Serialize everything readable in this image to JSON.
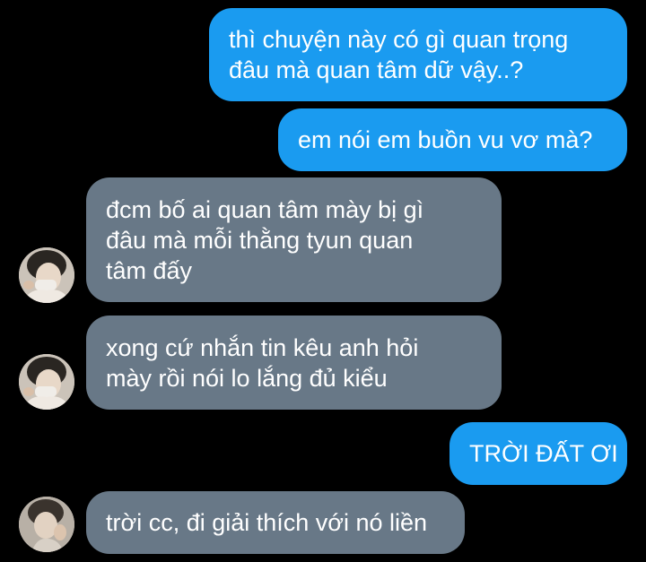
{
  "colors": {
    "background": "#000000",
    "outgoing_bubble": "#1a9bf0",
    "incoming_bubble": "#687887",
    "text": "#ffffff"
  },
  "messages": [
    {
      "direction": "outgoing",
      "lines": [
        "thì chuyện này có gì quan trọng",
        "đâu mà quan tâm dữ vậy..?"
      ]
    },
    {
      "direction": "outgoing",
      "lines": [
        "em nói em buồn vu vơ mà?"
      ]
    },
    {
      "direction": "incoming",
      "avatar": "profile-photo",
      "lines": [
        "đcm bố ai quan tâm mày bị gì",
        "đâu mà mỗi thằng tyun quan",
        "tâm đấy"
      ]
    },
    {
      "direction": "incoming",
      "avatar": "profile-photo",
      "lines": [
        "xong cứ nhắn tin kêu anh hỏi",
        "mày rồi nói lo lắng đủ kiểu"
      ]
    },
    {
      "direction": "outgoing",
      "lines": [
        "TRỜI ĐẤT ƠI"
      ]
    },
    {
      "direction": "incoming",
      "avatar": "profile-photo",
      "lines": [
        "trời cc, đi giải thích với nó liền"
      ]
    }
  ]
}
